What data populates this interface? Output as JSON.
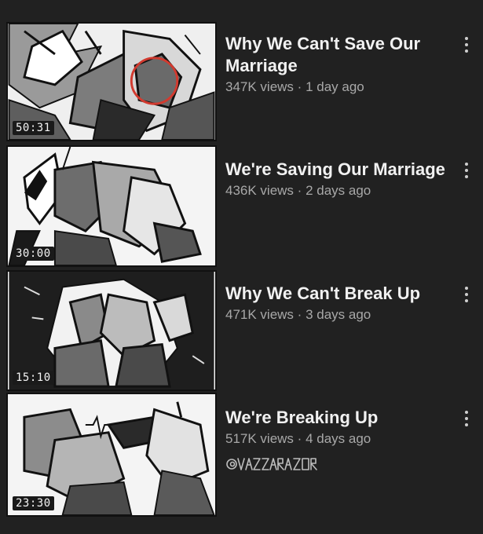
{
  "videos": [
    {
      "title": "Why We Can't Save Our Marriage",
      "views": "347K views",
      "age": "1 day ago",
      "duration": "50:31",
      "more_icon": "more-vert-icon"
    },
    {
      "title": "We're Saving Our Marriage",
      "views": "436K views",
      "age": "2 days ago",
      "duration": "30:00",
      "more_icon": "more-vert-icon"
    },
    {
      "title": "Why We Can't Break Up",
      "views": "471K views",
      "age": "3 days ago",
      "duration": "15:10",
      "more_icon": "more-vert-icon"
    },
    {
      "title": "We're Breaking Up",
      "views": "517K views",
      "age": "4 days ago",
      "duration": "23:30",
      "more_icon": "more-vert-icon"
    }
  ],
  "signature": "@RAZZARAZOR",
  "colors": {
    "background": "#212121",
    "title": "#f1f1f1",
    "meta": "#a8a8a8",
    "circle_accent": "#d23a2f"
  }
}
